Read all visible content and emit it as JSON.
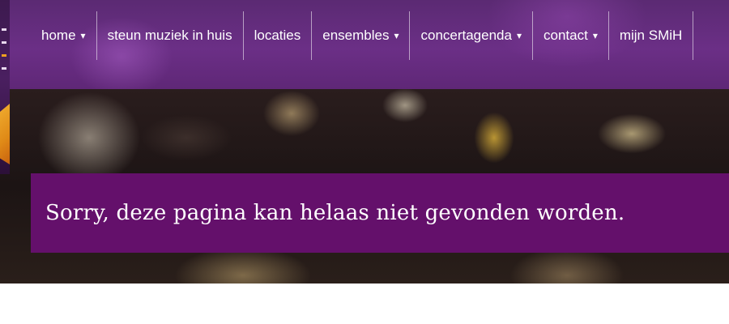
{
  "nav": {
    "items": [
      {
        "label": "home",
        "caret": "▾"
      },
      {
        "label": "steun muziek in huis",
        "caret": ""
      },
      {
        "label": "locaties",
        "caret": ""
      },
      {
        "label": "ensembles",
        "caret": "▾"
      },
      {
        "label": "concertagenda",
        "caret": "▾"
      },
      {
        "label": "contact",
        "caret": "▾"
      },
      {
        "label": "mijn SMiH",
        "caret": ""
      }
    ]
  },
  "banner": {
    "message": "Sorry, deze pagina kan helaas niet gevonden worden."
  },
  "colors": {
    "nav_background": "#6b2f86",
    "banner_background": "#64106b",
    "text": "#ffffff"
  }
}
